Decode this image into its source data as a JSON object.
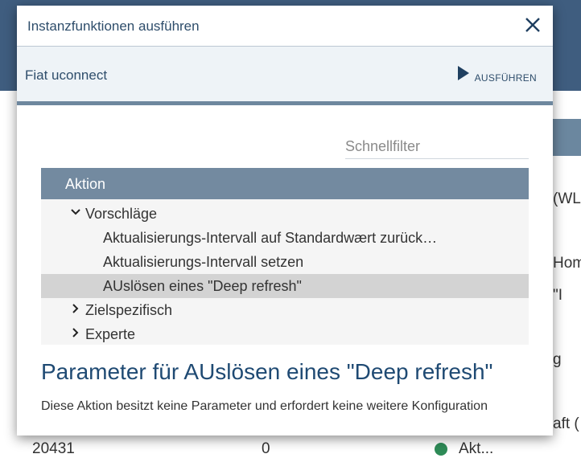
{
  "background": {
    "side_texts": [
      "(WL",
      "Hom",
      "\"I",
      "g",
      "aft ("
    ],
    "bottom_row": {
      "id": "20431",
      "value": "0",
      "label": "Akt..."
    }
  },
  "dialog": {
    "title": "Instanzfunktionen ausführen",
    "close_icon": "close-icon",
    "instance_name": "Fiat uconnect",
    "run_label": "AUSFÜHREN",
    "filter_placeholder": "Schnellfilter",
    "tree": {
      "header": "Aktion",
      "items": [
        {
          "label": "Vorschläge",
          "expanded": true
        },
        {
          "label": "Aktualisierungs-Intervall auf Standardwært zurück…"
        },
        {
          "label": "Aktualisierungs-Intervall setzen"
        },
        {
          "label": "AUslösen eines \"Deep refresh\"",
          "selected": true
        },
        {
          "label": "Zielspezifisch",
          "expanded": false
        },
        {
          "label": "Experte",
          "expanded": false
        }
      ]
    },
    "param_title": "Parameter für AUslösen eines \"Deep refresh\"",
    "param_desc": "Diese Aktion besitzt keine Parameter und erfordert keine weitere Konfiguration"
  },
  "colors": {
    "header_blue": "#3f5d7f",
    "tree_header": "#738aa0",
    "selection": "#d3d3d3",
    "title_text": "#1f4a73"
  }
}
